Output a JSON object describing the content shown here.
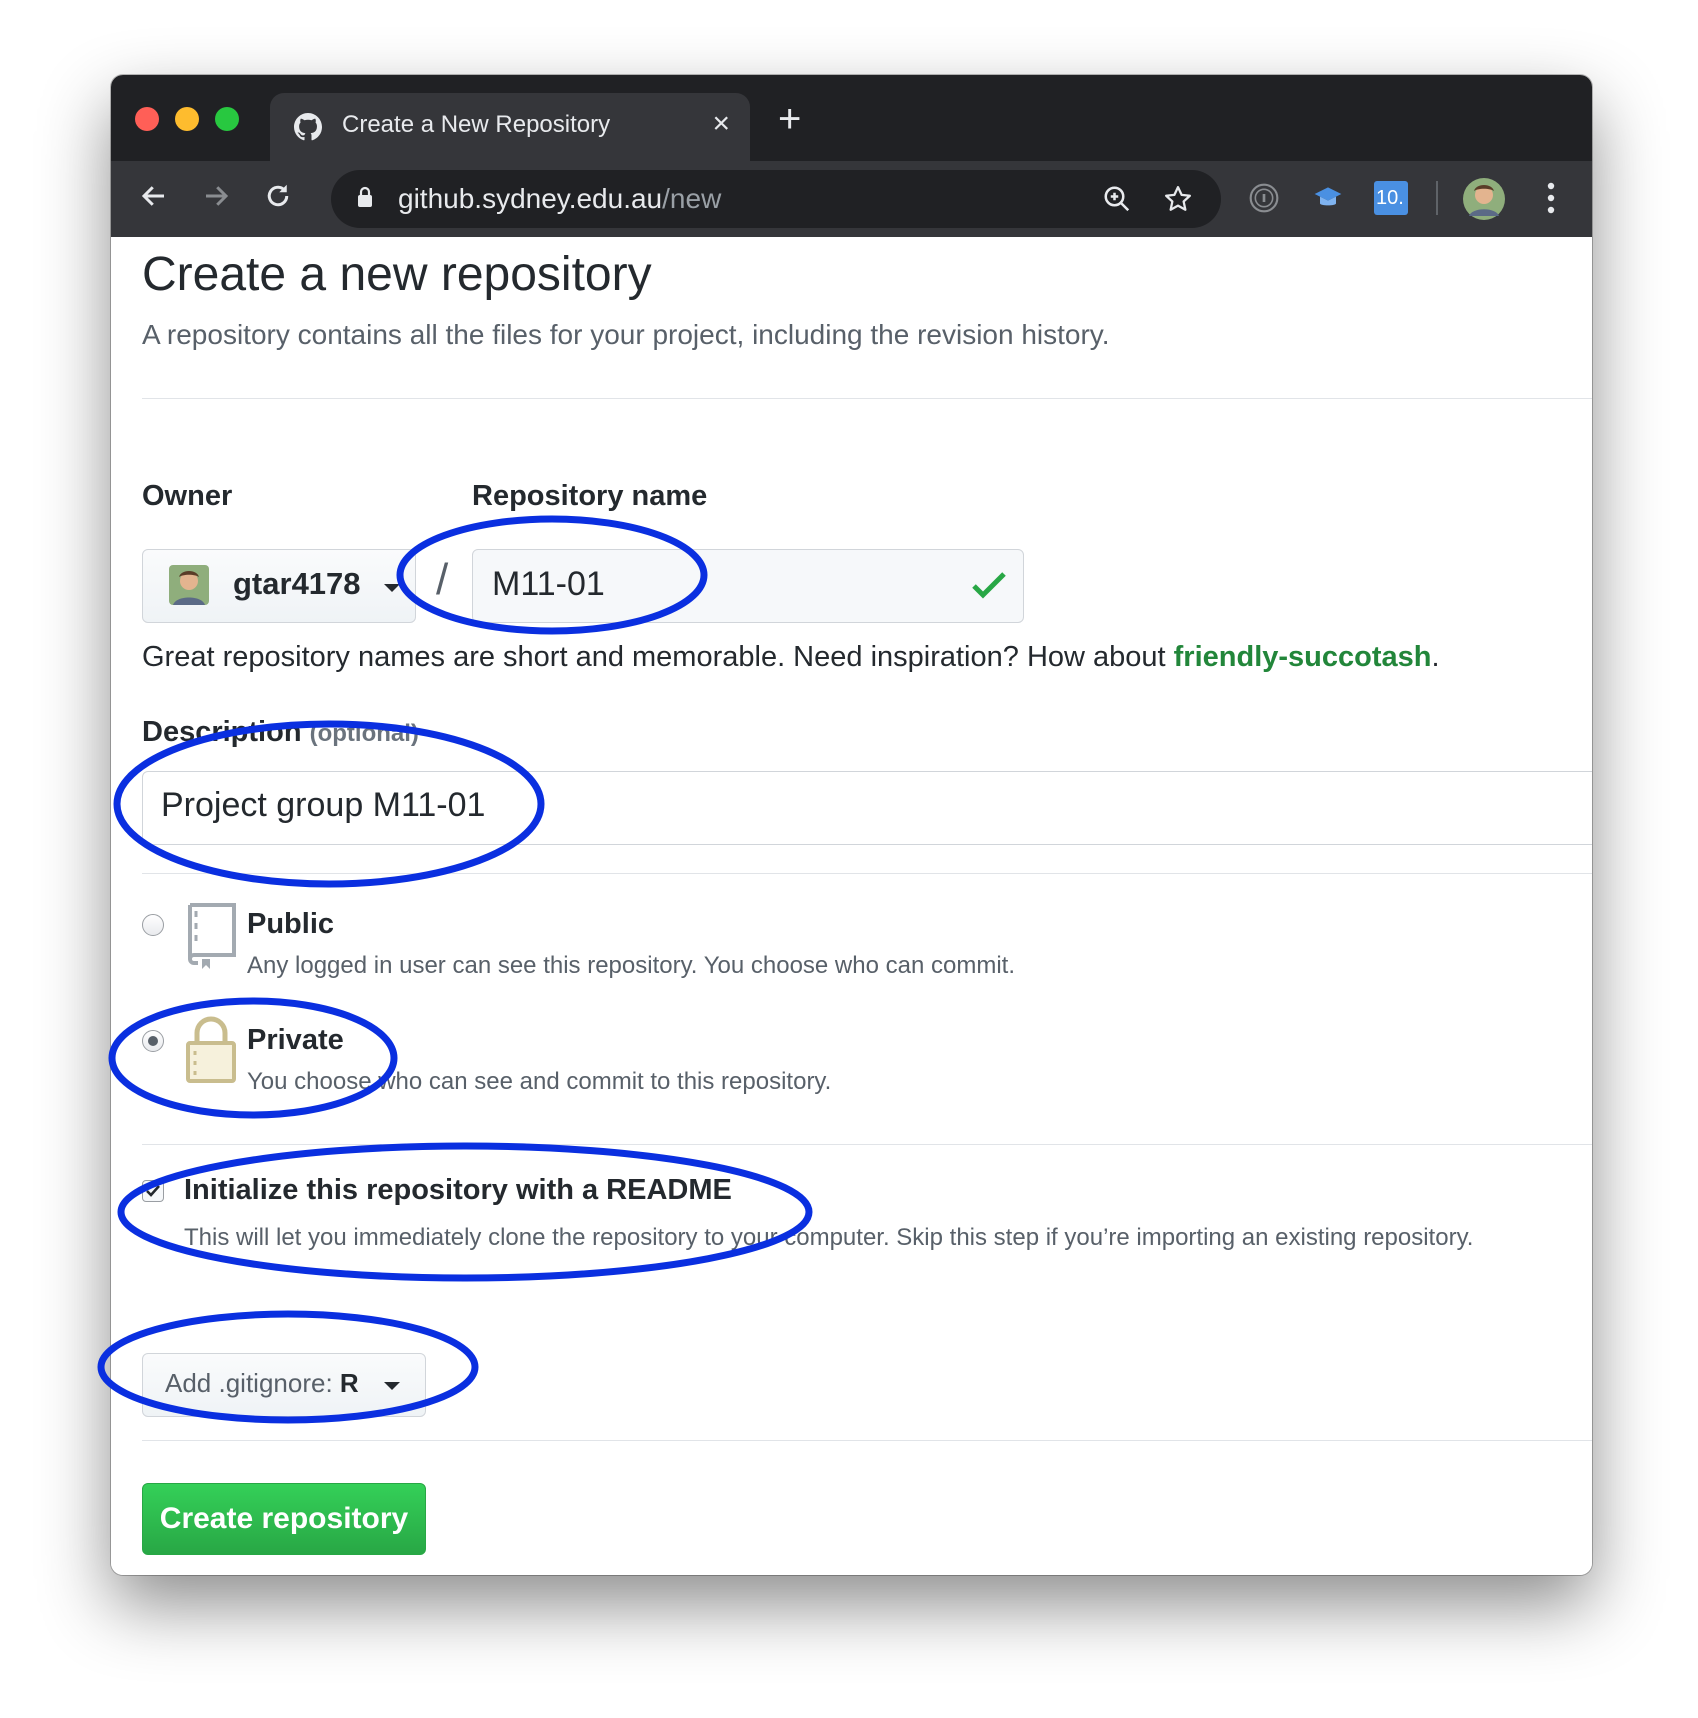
{
  "browser": {
    "tab_title": "Create a New Repository",
    "close_glyph": "×",
    "new_tab_glyph": "+",
    "url_host": "github.sydney.edu.au",
    "url_path": "/new",
    "extension_badge": "10."
  },
  "page": {
    "title": "Create a new repository",
    "subtitle": "A repository contains all the files for your project, including the revision history."
  },
  "form": {
    "owner_label": "Owner",
    "owner_name": "gtar4178",
    "slash": "/",
    "repo_label": "Repository name",
    "repo_value": "M11-01",
    "hint_prefix": "Great repository names are short and memorable. Need inspiration? How about ",
    "hint_suggestion": "friendly-succotash",
    "hint_suffix": ".",
    "description_label": "Description",
    "description_optional": "(optional)",
    "description_value": "Project group M11-01",
    "visibility": {
      "public_title": "Public",
      "public_desc": "Any logged in user can see this repository. You choose who can commit.",
      "private_title": "Private",
      "private_desc": "You choose who can see and commit to this repository.",
      "selected": "Private"
    },
    "init_readme_title": "Initialize this repository with a README",
    "init_readme_desc": "This will let you immediately clone the repository to your computer. Skip this step if you’re importing an existing repository.",
    "init_readme_checked": true,
    "gitignore_prefix": "Add .gitignore: ",
    "gitignore_value": "R",
    "create_button": "Create repository"
  },
  "colors": {
    "annotation": "#0a2fe0",
    "primary_green": "#28a745",
    "suggestion_green": "#22863a"
  },
  "icons": [
    "github-icon",
    "back-icon",
    "forward-icon",
    "reload-icon",
    "lock-icon",
    "zoom-icon",
    "star-icon",
    "info-extension-icon",
    "cap-extension-icon",
    "profile-avatar",
    "menu-icon",
    "checkmark-icon",
    "repo-icon",
    "padlock-icon"
  ]
}
